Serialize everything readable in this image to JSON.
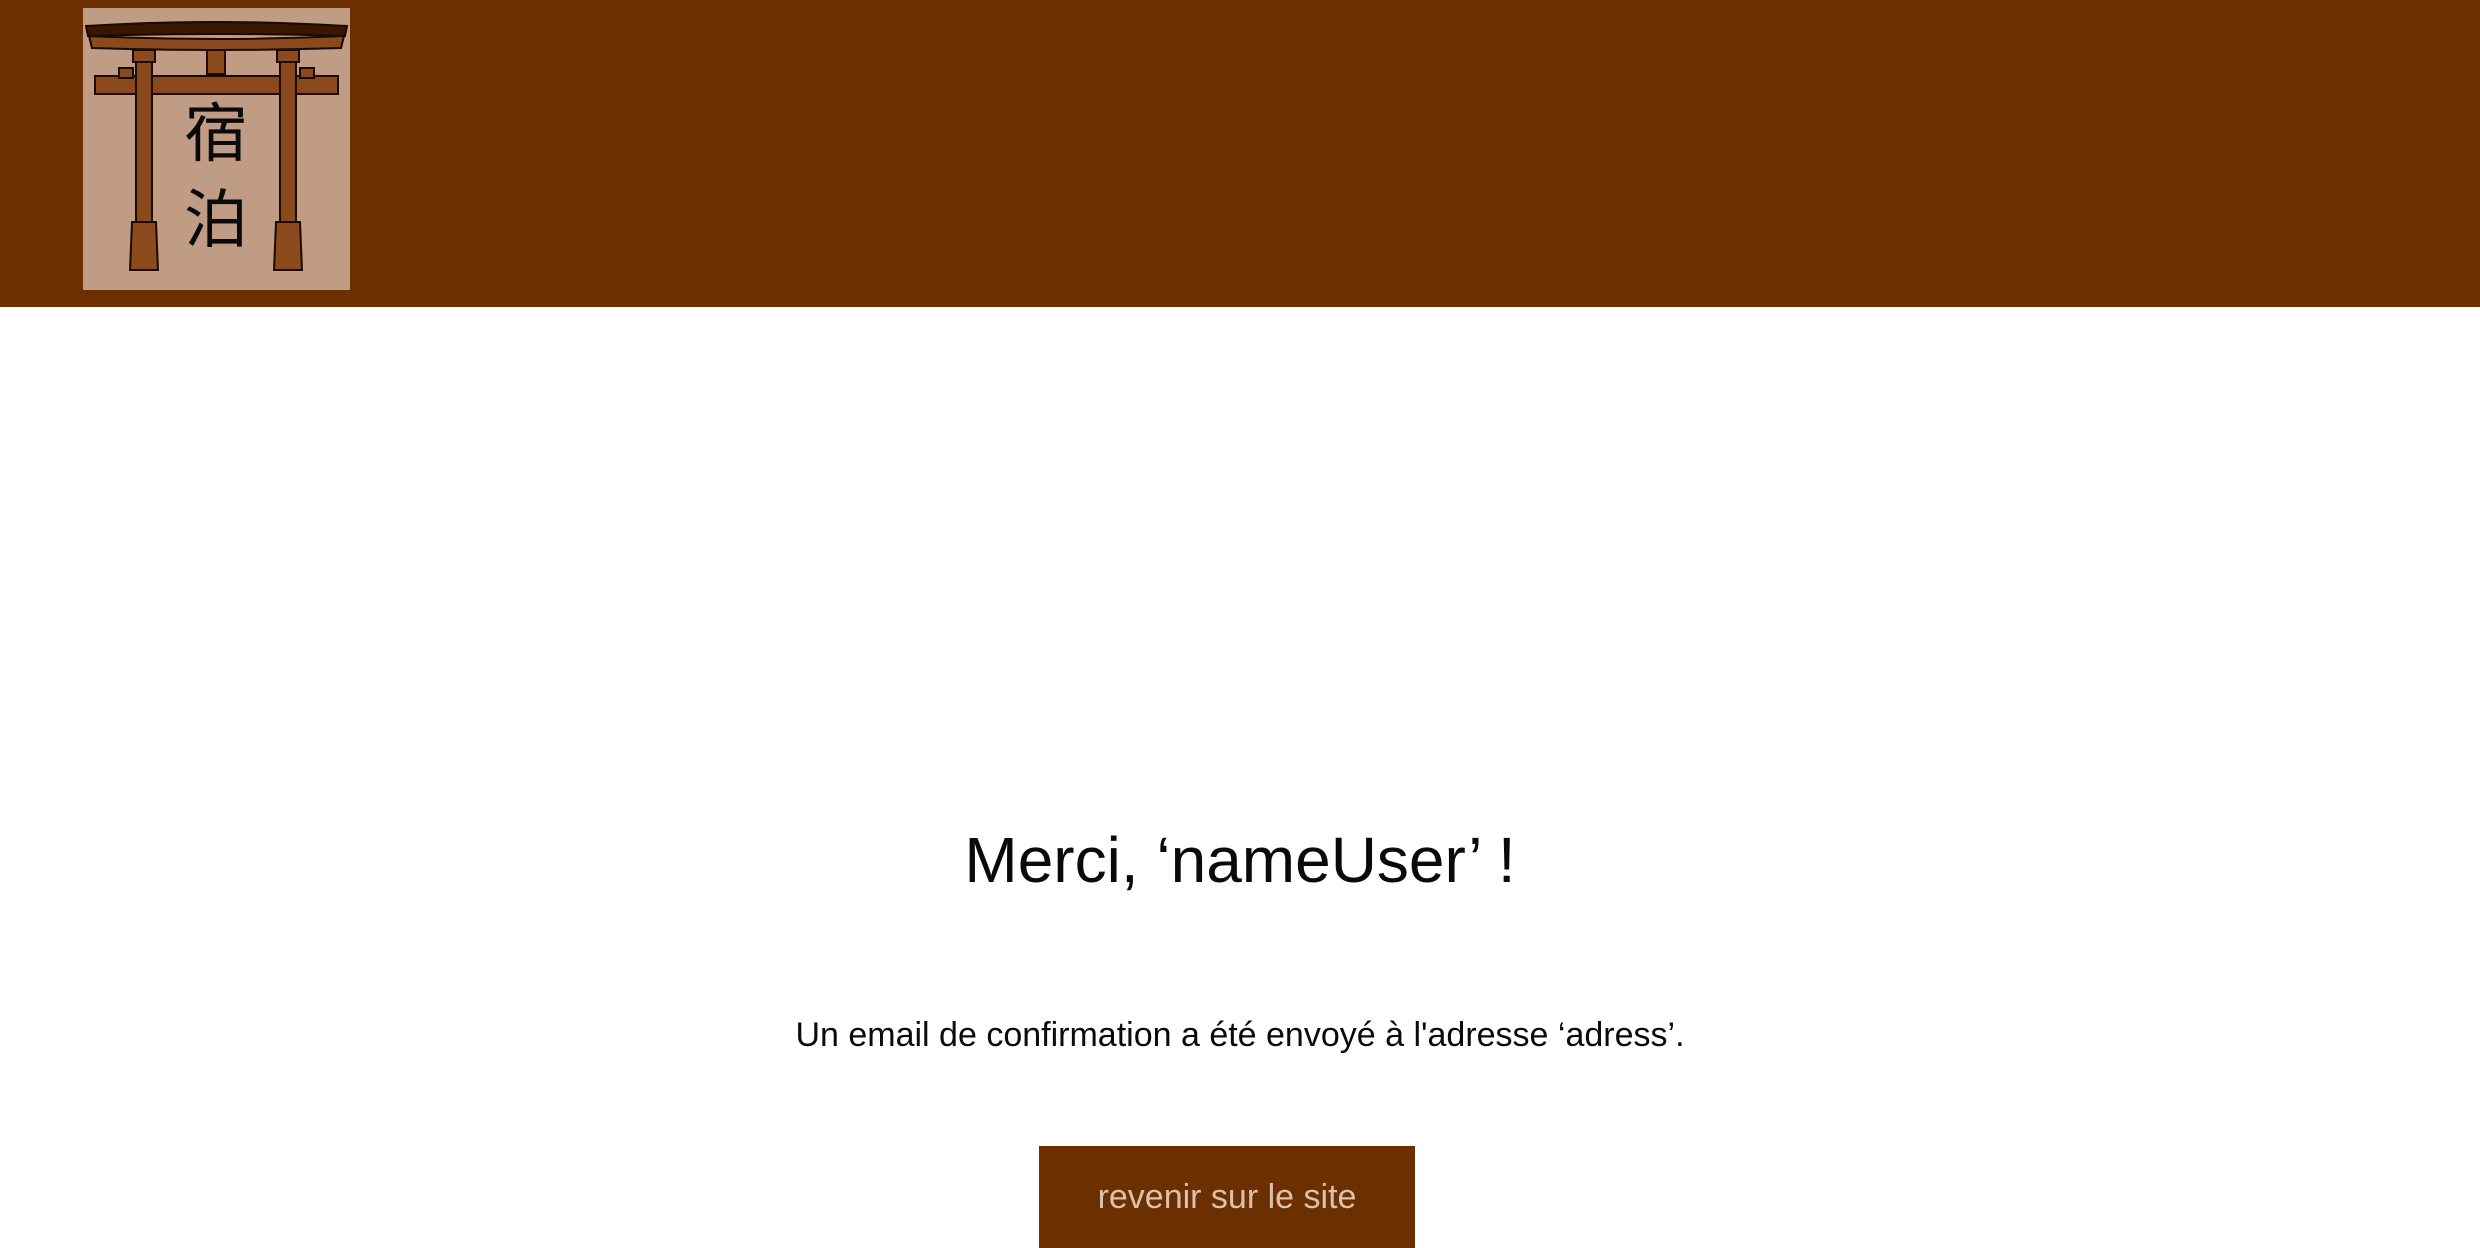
{
  "logo": {
    "icon": "torii-gate-icon",
    "kanji_top": "宿",
    "kanji_bottom": "泊"
  },
  "confirmation": {
    "title": "Merci, ‘nameUser’ !",
    "message": "Un email de confirmation a été envoyé à l'adresse  ‘adress’.",
    "back_button_label": "revenir sur le site"
  },
  "colors": {
    "header_bg": "#6b2f00",
    "logo_bg": "#c19c84",
    "button_bg": "#6b2f00",
    "button_text": "#d9c1ae",
    "text": "#0a0a0a"
  }
}
